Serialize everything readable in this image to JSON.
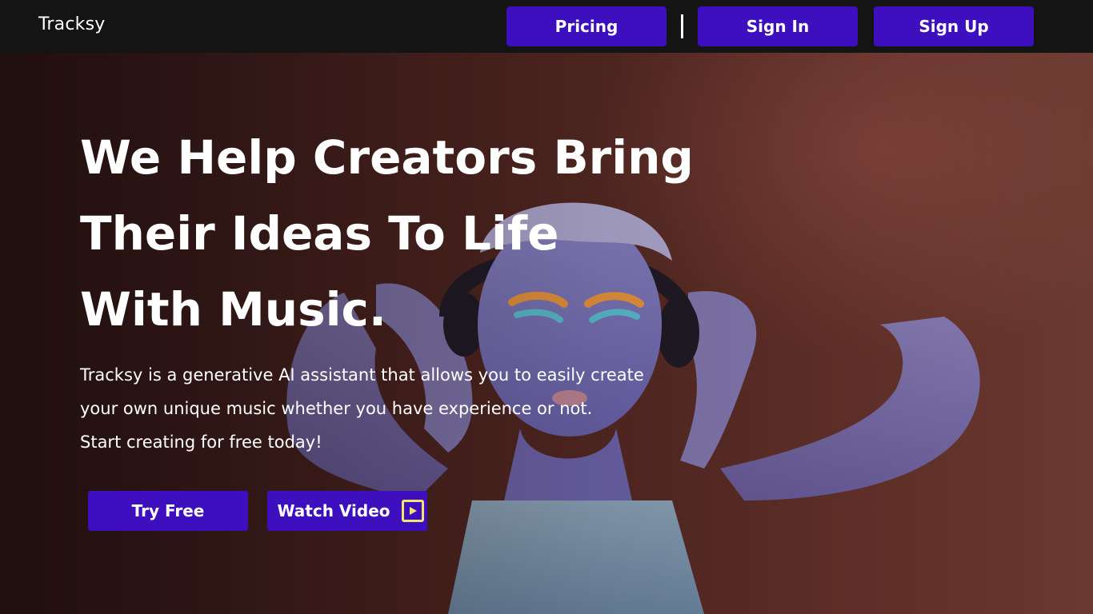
{
  "nav": {
    "brand": "Tracksy",
    "pricing_label": "Pricing",
    "signin_label": "Sign In",
    "signup_label": "Sign Up"
  },
  "hero": {
    "headline_lines": [
      "We Help Creators Bring",
      "Their Ideas To Life",
      "With Music."
    ],
    "description_lines": [
      "Tracksy is a generative AI assistant that allows you to easily create",
      "your own unique music whether you have experience or not.",
      "Start creating for free today!"
    ],
    "try_free_label": "Try Free",
    "watch_video_label": "Watch Video",
    "play_icon": "play-icon"
  },
  "colors": {
    "button_bg": "#3d0fbf",
    "topbar_bg": "#141414",
    "play_icon_accent": "#f2e56b"
  }
}
